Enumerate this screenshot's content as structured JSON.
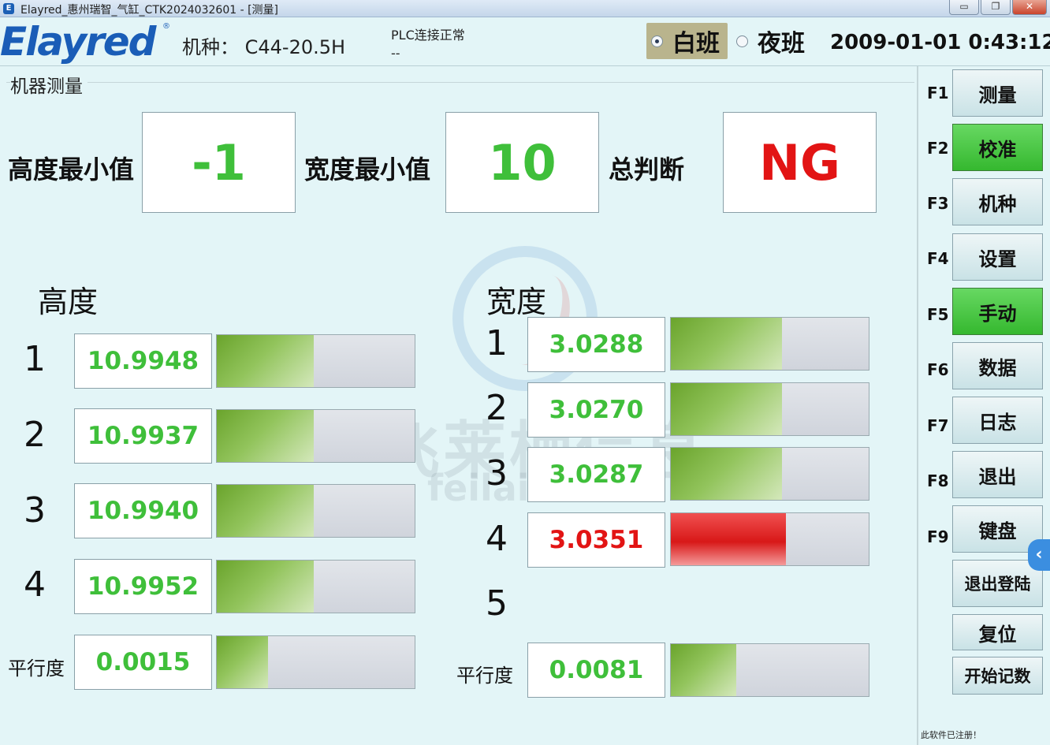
{
  "window": {
    "title": "Elayred_惠州瑞智_气缸_CTK2024032601 - [测量]",
    "controls": {
      "minimize": "▭",
      "restore": "❐",
      "close": "✕"
    }
  },
  "header": {
    "logo": "Elayred",
    "logo_mark": "®",
    "model_label": "机种： C44-20.5H",
    "plc_status": "PLC连接正常",
    "plc_sub": "--",
    "shift_day": "白班",
    "shift_night": "夜班",
    "shift_selected": "day",
    "datetime": "2009-01-01 0:43:12"
  },
  "group_title": "机器测量",
  "summary": {
    "height_min_label": "高度最小值",
    "height_min_value": "-1",
    "width_min_label": "宽度最小值",
    "width_min_value": "10",
    "verdict_label": "总判断",
    "verdict_value": "NG",
    "status_colors": {
      "ok": "#3fbf3a",
      "ng": "#e21414"
    }
  },
  "height": {
    "title": "高度",
    "rows": [
      {
        "index": "1",
        "value": "10.9948",
        "fill": 0.49,
        "status": "ok"
      },
      {
        "index": "2",
        "value": "10.9937",
        "fill": 0.49,
        "status": "ok"
      },
      {
        "index": "3",
        "value": "10.9940",
        "fill": 0.49,
        "status": "ok"
      },
      {
        "index": "4",
        "value": "10.9952",
        "fill": 0.49,
        "status": "ok"
      }
    ],
    "parallel": {
      "label": "平行度",
      "value": "0.0015",
      "fill": 0.26,
      "status": "ok"
    }
  },
  "width": {
    "title": "宽度",
    "rows": [
      {
        "index": "1",
        "value": "3.0288",
        "fill": 0.56,
        "status": "ok"
      },
      {
        "index": "2",
        "value": "3.0270",
        "fill": 0.56,
        "status": "ok"
      },
      {
        "index": "3",
        "value": "3.0287",
        "fill": 0.56,
        "status": "ok"
      },
      {
        "index": "4",
        "value": "3.0351",
        "fill": 0.58,
        "status": "ng"
      },
      {
        "index": "5"
      }
    ],
    "parallel": {
      "label": "平行度",
      "value": "0.0081",
      "fill": 0.33,
      "status": "ok"
    }
  },
  "sidebar": {
    "buttons": [
      {
        "key": "F1",
        "label": "测量",
        "active": false
      },
      {
        "key": "F2",
        "label": "校准",
        "active": true
      },
      {
        "key": "F3",
        "label": "机种",
        "active": false
      },
      {
        "key": "F4",
        "label": "设置",
        "active": false
      },
      {
        "key": "F5",
        "label": "手动",
        "active": true
      },
      {
        "key": "F6",
        "label": "数据",
        "active": false
      },
      {
        "key": "F7",
        "label": "日志",
        "active": false
      },
      {
        "key": "F8",
        "label": "退出",
        "active": false
      },
      {
        "key": "F9",
        "label": "键盘",
        "active": false
      }
    ],
    "extra_buttons": [
      "退出登陆",
      "复位",
      "开始记数"
    ],
    "edge_tab": "‹",
    "registered_note": "此软件已注册！"
  },
  "watermark": {
    "text": "飞莱栖信息",
    "url": "feilaixi.com"
  }
}
